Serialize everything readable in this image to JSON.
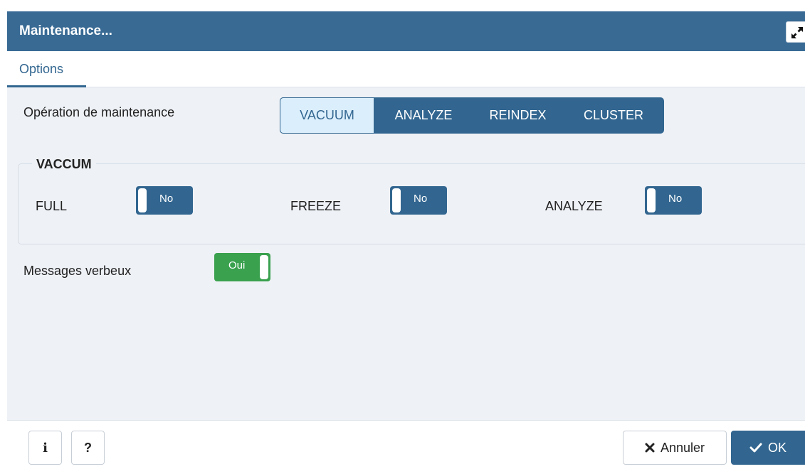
{
  "dialog": {
    "title": "Maintenance..."
  },
  "tabs": [
    {
      "label": "Options"
    }
  ],
  "operation": {
    "label": "Opération de maintenance",
    "options": [
      "VACUUM",
      "ANALYZE",
      "REINDEX",
      "CLUSTER"
    ],
    "selected": "VACUUM"
  },
  "vacuum_group": {
    "legend": "VACCUM",
    "switches": [
      {
        "label": "FULL",
        "value": "No"
      },
      {
        "label": "FREEZE",
        "value": "No"
      },
      {
        "label": "ANALYZE",
        "value": "No"
      }
    ]
  },
  "verbose": {
    "label": "Messages verbeux",
    "value": "Oui"
  },
  "footer": {
    "info_label": "i",
    "help_label": "?",
    "cancel_label": "Annuler",
    "ok_label": "OK"
  },
  "colors": {
    "primary": "#326690",
    "header": "#386a94",
    "success": "#3aa14f",
    "panel": "#eef1f6"
  }
}
